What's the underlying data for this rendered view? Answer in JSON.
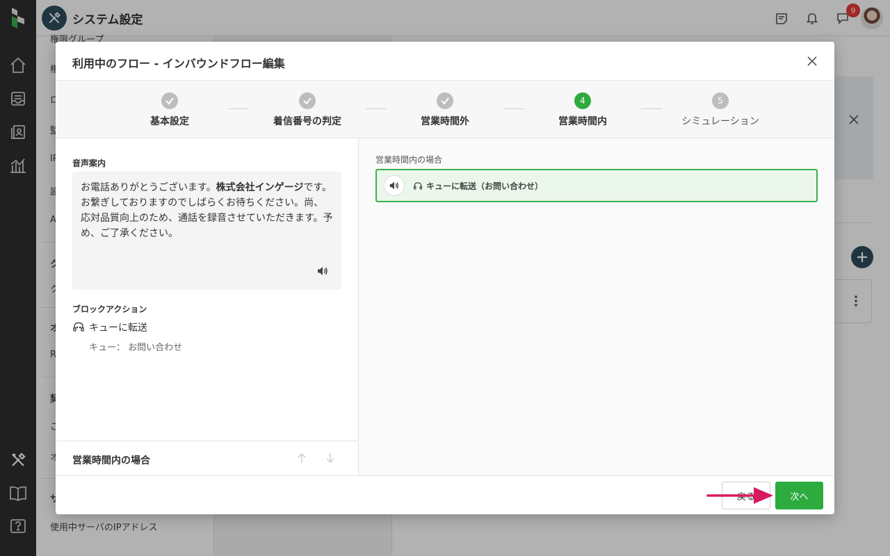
{
  "header": {
    "title": "システム設定",
    "notification_count": "9"
  },
  "background_sidebar": {
    "items": [
      "権限グループ",
      "権",
      "ロ",
      "監",
      "IP",
      "設",
      "A",
      "ク",
      "ク",
      "オ",
      "R",
      "契",
      "こ",
      "オ",
      "サ",
      "使用中サーバのIPアドレス"
    ]
  },
  "modal": {
    "title": "利用中のフロー - インバウンドフロー編集",
    "steps": [
      {
        "label": "基本設定",
        "state": "done"
      },
      {
        "label": "着信番号の判定",
        "state": "done"
      },
      {
        "label": "営業時間外",
        "state": "done"
      },
      {
        "label": "営業時間内",
        "state": "active",
        "number": "4"
      },
      {
        "label": "シミュレーション",
        "state": "todo",
        "number": "5"
      }
    ],
    "left": {
      "voice_label": "音声案内",
      "voice_text_1": "お電話ありがとうございます。",
      "voice_text_bold": "株式会社インゲージ",
      "voice_text_2": "です。",
      "voice_text_3": "お繋ぎしておりますのでしばらくお待ちください。尚、応対品質向上のため、通話を録音させていただきます。予め、ご了承ください。",
      "block_action_label": "ブロックアクション",
      "action_name": "キューに転送",
      "queue_label": "キュー：",
      "queue_value": "お問い合わせ",
      "footer_label": "営業時間内の場合"
    },
    "right": {
      "caption": "営業時間内の場合",
      "card_text": "キューに転送（お問い合わせ）"
    },
    "footer": {
      "back_label": "戻る",
      "next_label": "次へ"
    }
  },
  "colors": {
    "accent_green": "#2eab3f",
    "highlight_green_bg": "#eaf7ea",
    "pointer_pink": "#d81b60",
    "rail_dark": "#2e2e2e"
  }
}
